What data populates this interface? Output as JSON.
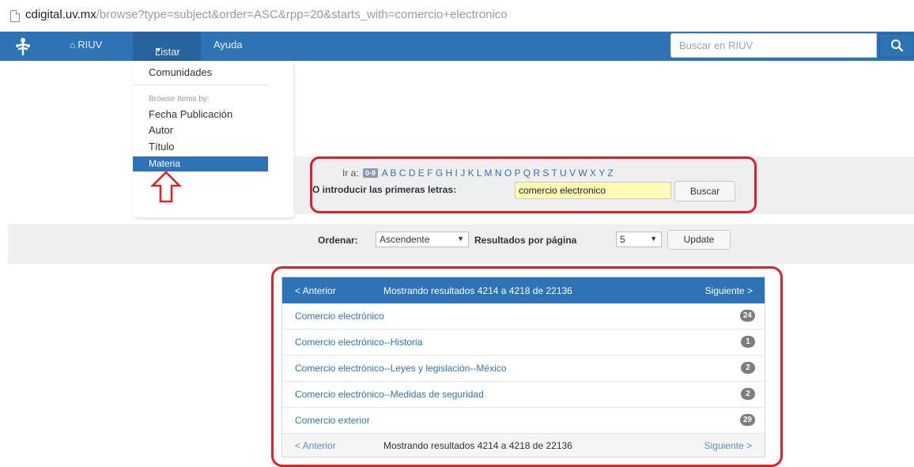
{
  "browser": {
    "url_host": "cdigital.uv.mx",
    "url_path": "/browse?type=subject&order=ASC&rpp=20&starts_with=comercio+electronico"
  },
  "navbar": {
    "home_label": "RIUV",
    "listar_label": "Listar",
    "ayuda_label": "Ayuda",
    "search_placeholder": "Buscar en RIUV"
  },
  "dropdown": {
    "comunidades": "Comunidades",
    "header": "Browse Items by:",
    "fecha": "Fecha Publicación",
    "autor": "Autor",
    "titulo": "Título",
    "materia": "Materia"
  },
  "jump": {
    "ir_a": "Ir a:",
    "badge_09": "0-9",
    "letters": [
      "A",
      "B",
      "C",
      "D",
      "E",
      "F",
      "G",
      "H",
      "I",
      "J",
      "K",
      "L",
      "M",
      "N",
      "O",
      "P",
      "Q",
      "R",
      "S",
      "T",
      "U",
      "V",
      "W",
      "X",
      "Y",
      "Z"
    ],
    "prompt": "O introducir las primeras letras:",
    "input_value": "comercio electronico",
    "buscar_label": "Buscar"
  },
  "sort": {
    "ordenar_label": "Ordenar:",
    "order_value": "Ascendente",
    "rpp_label": "Resultados por página",
    "rpp_value": "5",
    "update_label": "Update"
  },
  "results": {
    "prev_label": "< Anterior",
    "next_label": "Siguiente >",
    "status": "Mostrando resultados 4214 a 4218 de 22136",
    "items": [
      {
        "title": "Comercio electrónico",
        "count": "24"
      },
      {
        "title": "Comercio electrónico--Historia",
        "count": "1"
      },
      {
        "title": "Comercio electrónico--Leyes y legislación--México",
        "count": "2"
      },
      {
        "title": "Comercio electrónico--Medidas de seguridad",
        "count": "2"
      },
      {
        "title": "Comercio exterior",
        "count": "29"
      }
    ]
  },
  "colors": {
    "brand_blue": "#2f73b7",
    "highlight_red": "#d9232f",
    "input_highlight": "#fffbb4"
  }
}
